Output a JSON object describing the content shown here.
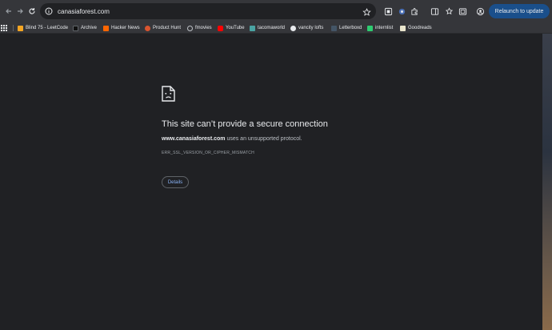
{
  "address_bar": {
    "url": "canasiaforest.com"
  },
  "toolbar": {
    "relaunch_label": "Relaunch to update"
  },
  "bookmarks": [
    {
      "label": "Blind 75 - LeetCode",
      "color": "#f5a623"
    },
    {
      "label": "Archive",
      "color": "#111111"
    },
    {
      "label": "Hacker News",
      "color": "#ff6600"
    },
    {
      "label": "Product Hunt",
      "color": "#da552f"
    },
    {
      "label": "fmovies",
      "color": "#bdc1c6"
    },
    {
      "label": "YouTube",
      "color": "#ff0000"
    },
    {
      "label": "tacomaworld",
      "color": "#4aa3a2"
    },
    {
      "label": "vancity lofts",
      "color": "#e8eaed"
    },
    {
      "label": "Letterboxd",
      "color": "#445566"
    },
    {
      "label": "internlist",
      "color": "#2ecc71"
    },
    {
      "label": "Goodreads",
      "color": "#e9e5cd"
    }
  ],
  "error": {
    "title": "This site can’t provide a secure connection",
    "domain": "www.canasiaforest.com",
    "message": " uses an unsupported protocol.",
    "code": "ERR_SSL_VERSION_OR_CIPHER_MISMATCH",
    "details_label": "Details"
  }
}
